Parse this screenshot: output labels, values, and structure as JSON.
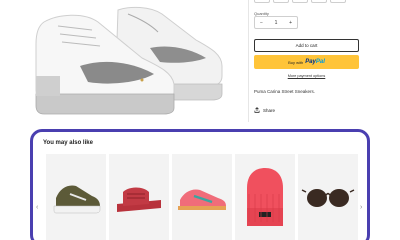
{
  "product": {
    "quantity_label": "Quantity",
    "quantity_value": "1",
    "decrement": "−",
    "increment": "+",
    "add_to_cart": "Add to cart",
    "buy_with": "Buy with",
    "paypal_pay": "Pay",
    "paypal_pal": "Pal",
    "more_payment": "More payment options",
    "description": "Puma Carina Street Sneakers.",
    "share_label": "Share"
  },
  "recommendations": {
    "title": "You may also like",
    "items": [
      {
        "icon": "sneaker-olive-icon"
      },
      {
        "icon": "slide-sandal-red-icon"
      },
      {
        "icon": "sneaker-pink-icon"
      },
      {
        "icon": "beanie-red-icon"
      },
      {
        "icon": "sunglasses-icon"
      }
    ]
  },
  "colors": {
    "accent_border": "#4a3fb0",
    "paypal_yellow": "#ffc439"
  }
}
